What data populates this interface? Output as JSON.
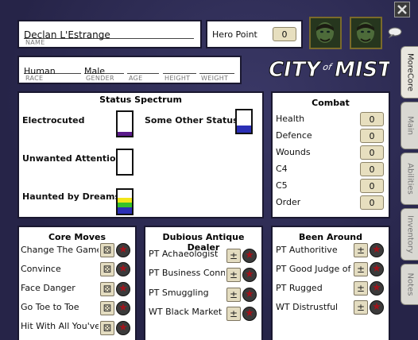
{
  "header": {
    "name": "Declan L'Estrange",
    "name_label": "NAME",
    "hero_point_label": "Hero Point",
    "hero_point_value": "0"
  },
  "identity": {
    "race": "Human",
    "gender": "Male",
    "labels": [
      "RACE",
      "GENDER",
      "AGE",
      "HEIGHT",
      "WEIGHT"
    ]
  },
  "logo_text": "City of Mist",
  "status_spectrum": {
    "title": "Status Spectrum",
    "items": [
      {
        "label": "Electrocuted"
      },
      {
        "label": "Some Other Status"
      },
      {
        "label": "Unwanted Attention"
      },
      {
        "label": "Haunted by Dreams"
      }
    ]
  },
  "combat": {
    "title": "Combat",
    "rows": [
      {
        "label": "Health",
        "value": "0"
      },
      {
        "label": "Defence",
        "value": "0"
      },
      {
        "label": "Wounds",
        "value": "0"
      },
      {
        "label": "C4",
        "value": "0"
      },
      {
        "label": "C5",
        "value": "0"
      },
      {
        "label": "Order",
        "value": "0"
      }
    ]
  },
  "core_moves": {
    "title": "Core Moves",
    "items": [
      "Change The Game",
      "Convince",
      "Face Danger",
      "Go Toe to Toe",
      "Hit With All You've"
    ]
  },
  "dubious": {
    "title": "Dubious Antique Dealer",
    "items": [
      "PT Achaeologist",
      "PT Business Connections",
      "PT Smuggling",
      "WT Black Market"
    ]
  },
  "been_around": {
    "title": "Been Around",
    "items": [
      "PT Authoritive",
      "PT Good Judge of",
      "PT Rugged",
      "WT Distrustful"
    ]
  },
  "tabs": [
    "MoreCore",
    "Main",
    "Abilities",
    "Inventory",
    "Notes"
  ],
  "icons": {
    "close": "close-icon",
    "chat": "speech-bubble-icon",
    "portrait": "character-portrait",
    "move_button": "dice-icon",
    "star": "star-icon"
  },
  "colors": {
    "background": "#2d2b52",
    "counter": "#e7dfbf",
    "status_fill_blue": "#2b2fb5",
    "status_fill_purple": "#5a1a8a",
    "status_fill_green": "#35c22a",
    "status_fill_yellow": "#f2e619",
    "star": "#a0131b"
  }
}
